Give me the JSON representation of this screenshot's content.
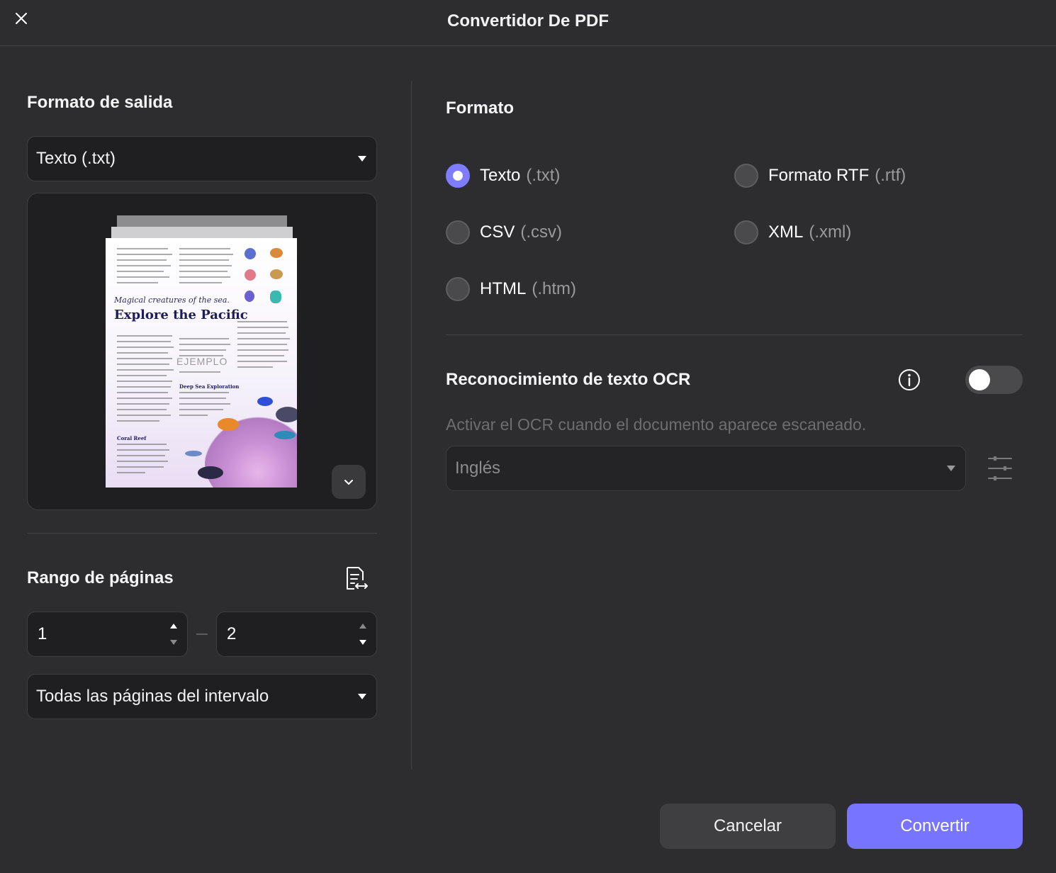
{
  "window": {
    "title": "Convertidor De PDF"
  },
  "left": {
    "output_format_title": "Formato de salida",
    "output_format_value": "Texto (.txt)",
    "preview": {
      "headline_italic": "Magical creatures of the sea.",
      "headline": "Explore the Pacific",
      "watermark": "EJEMPLO",
      "subhead_1": "Coral Reef",
      "subhead_2": "Deep Sea Exploration"
    },
    "page_range_title": "Rango de páginas",
    "range_from": "1",
    "range_to": "2",
    "page_subset_value": "Todas las páginas del intervalo"
  },
  "right": {
    "format_title": "Formato",
    "formats": [
      {
        "label": "Texto",
        "ext": "(.txt)",
        "selected": true
      },
      {
        "label": "Formato RTF",
        "ext": "(.rtf)",
        "selected": false
      },
      {
        "label": "CSV",
        "ext": "(.csv)",
        "selected": false
      },
      {
        "label": "XML",
        "ext": "(.xml)",
        "selected": false
      },
      {
        "label": "HTML",
        "ext": "(.htm)",
        "selected": false
      }
    ],
    "ocr_title": "Reconocimiento de texto OCR",
    "ocr_enabled": false,
    "ocr_description": "Activar el OCR cuando el documento aparece escaneado.",
    "ocr_language": "Inglés"
  },
  "footer": {
    "cancel_label": "Cancelar",
    "convert_label": "Convertir"
  },
  "colors": {
    "accent": "#7774ff",
    "background": "#2d2d2f",
    "field": "#1f1f21"
  }
}
